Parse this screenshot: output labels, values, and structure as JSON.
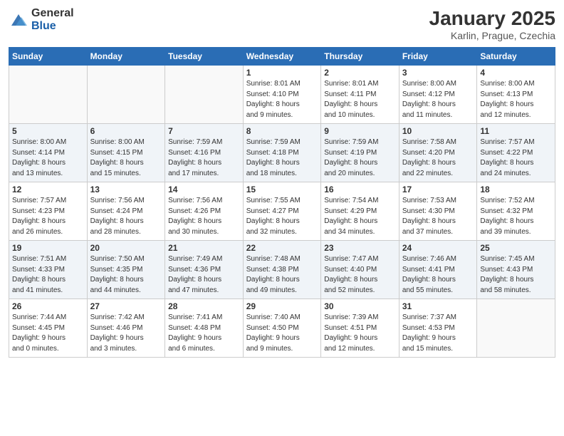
{
  "header": {
    "logo_general": "General",
    "logo_blue": "Blue",
    "title": "January 2025",
    "subtitle": "Karlin, Prague, Czechia"
  },
  "weekdays": [
    "Sunday",
    "Monday",
    "Tuesday",
    "Wednesday",
    "Thursday",
    "Friday",
    "Saturday"
  ],
  "weeks": [
    [
      {
        "day": "",
        "info": ""
      },
      {
        "day": "",
        "info": ""
      },
      {
        "day": "",
        "info": ""
      },
      {
        "day": "1",
        "info": "Sunrise: 8:01 AM\nSunset: 4:10 PM\nDaylight: 8 hours\nand 9 minutes."
      },
      {
        "day": "2",
        "info": "Sunrise: 8:01 AM\nSunset: 4:11 PM\nDaylight: 8 hours\nand 10 minutes."
      },
      {
        "day": "3",
        "info": "Sunrise: 8:00 AM\nSunset: 4:12 PM\nDaylight: 8 hours\nand 11 minutes."
      },
      {
        "day": "4",
        "info": "Sunrise: 8:00 AM\nSunset: 4:13 PM\nDaylight: 8 hours\nand 12 minutes."
      }
    ],
    [
      {
        "day": "5",
        "info": "Sunrise: 8:00 AM\nSunset: 4:14 PM\nDaylight: 8 hours\nand 13 minutes."
      },
      {
        "day": "6",
        "info": "Sunrise: 8:00 AM\nSunset: 4:15 PM\nDaylight: 8 hours\nand 15 minutes."
      },
      {
        "day": "7",
        "info": "Sunrise: 7:59 AM\nSunset: 4:16 PM\nDaylight: 8 hours\nand 17 minutes."
      },
      {
        "day": "8",
        "info": "Sunrise: 7:59 AM\nSunset: 4:18 PM\nDaylight: 8 hours\nand 18 minutes."
      },
      {
        "day": "9",
        "info": "Sunrise: 7:59 AM\nSunset: 4:19 PM\nDaylight: 8 hours\nand 20 minutes."
      },
      {
        "day": "10",
        "info": "Sunrise: 7:58 AM\nSunset: 4:20 PM\nDaylight: 8 hours\nand 22 minutes."
      },
      {
        "day": "11",
        "info": "Sunrise: 7:57 AM\nSunset: 4:22 PM\nDaylight: 8 hours\nand 24 minutes."
      }
    ],
    [
      {
        "day": "12",
        "info": "Sunrise: 7:57 AM\nSunset: 4:23 PM\nDaylight: 8 hours\nand 26 minutes."
      },
      {
        "day": "13",
        "info": "Sunrise: 7:56 AM\nSunset: 4:24 PM\nDaylight: 8 hours\nand 28 minutes."
      },
      {
        "day": "14",
        "info": "Sunrise: 7:56 AM\nSunset: 4:26 PM\nDaylight: 8 hours\nand 30 minutes."
      },
      {
        "day": "15",
        "info": "Sunrise: 7:55 AM\nSunset: 4:27 PM\nDaylight: 8 hours\nand 32 minutes."
      },
      {
        "day": "16",
        "info": "Sunrise: 7:54 AM\nSunset: 4:29 PM\nDaylight: 8 hours\nand 34 minutes."
      },
      {
        "day": "17",
        "info": "Sunrise: 7:53 AM\nSunset: 4:30 PM\nDaylight: 8 hours\nand 37 minutes."
      },
      {
        "day": "18",
        "info": "Sunrise: 7:52 AM\nSunset: 4:32 PM\nDaylight: 8 hours\nand 39 minutes."
      }
    ],
    [
      {
        "day": "19",
        "info": "Sunrise: 7:51 AM\nSunset: 4:33 PM\nDaylight: 8 hours\nand 41 minutes."
      },
      {
        "day": "20",
        "info": "Sunrise: 7:50 AM\nSunset: 4:35 PM\nDaylight: 8 hours\nand 44 minutes."
      },
      {
        "day": "21",
        "info": "Sunrise: 7:49 AM\nSunset: 4:36 PM\nDaylight: 8 hours\nand 47 minutes."
      },
      {
        "day": "22",
        "info": "Sunrise: 7:48 AM\nSunset: 4:38 PM\nDaylight: 8 hours\nand 49 minutes."
      },
      {
        "day": "23",
        "info": "Sunrise: 7:47 AM\nSunset: 4:40 PM\nDaylight: 8 hours\nand 52 minutes."
      },
      {
        "day": "24",
        "info": "Sunrise: 7:46 AM\nSunset: 4:41 PM\nDaylight: 8 hours\nand 55 minutes."
      },
      {
        "day": "25",
        "info": "Sunrise: 7:45 AM\nSunset: 4:43 PM\nDaylight: 8 hours\nand 58 minutes."
      }
    ],
    [
      {
        "day": "26",
        "info": "Sunrise: 7:44 AM\nSunset: 4:45 PM\nDaylight: 9 hours\nand 0 minutes."
      },
      {
        "day": "27",
        "info": "Sunrise: 7:42 AM\nSunset: 4:46 PM\nDaylight: 9 hours\nand 3 minutes."
      },
      {
        "day": "28",
        "info": "Sunrise: 7:41 AM\nSunset: 4:48 PM\nDaylight: 9 hours\nand 6 minutes."
      },
      {
        "day": "29",
        "info": "Sunrise: 7:40 AM\nSunset: 4:50 PM\nDaylight: 9 hours\nand 9 minutes."
      },
      {
        "day": "30",
        "info": "Sunrise: 7:39 AM\nSunset: 4:51 PM\nDaylight: 9 hours\nand 12 minutes."
      },
      {
        "day": "31",
        "info": "Sunrise: 7:37 AM\nSunset: 4:53 PM\nDaylight: 9 hours\nand 15 minutes."
      },
      {
        "day": "",
        "info": ""
      }
    ]
  ]
}
